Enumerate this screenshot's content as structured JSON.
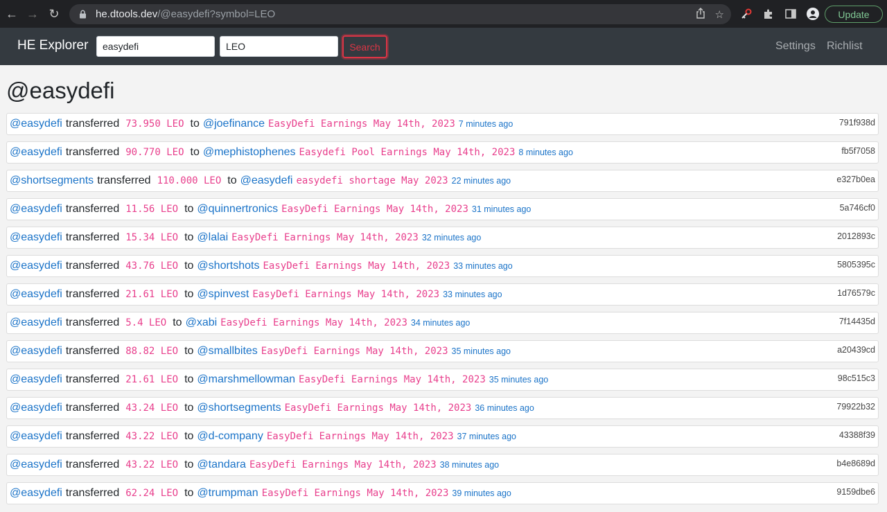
{
  "browser": {
    "url_host": "he.dtools.dev",
    "url_path": "/@easydefi?symbol=LEO",
    "update_label": "Update"
  },
  "navbar": {
    "brand": "HE Explorer",
    "account_value": "easydefi",
    "symbol_value": "LEO",
    "search_label": "Search",
    "settings_label": "Settings",
    "richlist_label": "Richlist"
  },
  "page": {
    "title": "@easydefi"
  },
  "transfers": [
    {
      "from": "@easydefi",
      "verb": "transferred",
      "amount": "73.950 LEO",
      "to_word": "to",
      "to": "@joefinance",
      "memo": "EasyDefi Earnings May 14th, 2023",
      "time": "7 minutes ago",
      "hash": "791f938d"
    },
    {
      "from": "@easydefi",
      "verb": "transferred",
      "amount": "90.770 LEO",
      "to_word": "to",
      "to": "@mephistophenes",
      "memo": "Easydefi Pool Earnings May 14th, 2023",
      "time": "8 minutes ago",
      "hash": "fb5f7058"
    },
    {
      "from": "@shortsegments",
      "verb": "transferred",
      "amount": "110.000 LEO",
      "to_word": "to",
      "to": "@easydefi",
      "memo": "easydefi shortage May 2023",
      "time": "22 minutes ago",
      "hash": "e327b0ea"
    },
    {
      "from": "@easydefi",
      "verb": "transferred",
      "amount": "11.56 LEO",
      "to_word": "to",
      "to": "@quinnertronics",
      "memo": "EasyDefi Earnings May 14th, 2023",
      "time": "31 minutes ago",
      "hash": "5a746cf0"
    },
    {
      "from": "@easydefi",
      "verb": "transferred",
      "amount": "15.34 LEO",
      "to_word": "to",
      "to": "@lalai",
      "memo": "EasyDefi Earnings May 14th, 2023",
      "time": "32 minutes ago",
      "hash": "2012893c"
    },
    {
      "from": "@easydefi",
      "verb": "transferred",
      "amount": "43.76 LEO",
      "to_word": "to",
      "to": "@shortshots",
      "memo": "EasyDefi Earnings May 14th, 2023",
      "time": "33 minutes ago",
      "hash": "5805395c"
    },
    {
      "from": "@easydefi",
      "verb": "transferred",
      "amount": "21.61 LEO",
      "to_word": "to",
      "to": "@spinvest",
      "memo": "EasyDefi Earnings May 14th, 2023",
      "time": "33 minutes ago",
      "hash": "1d76579c"
    },
    {
      "from": "@easydefi",
      "verb": "transferred",
      "amount": "5.4 LEO",
      "to_word": "to",
      "to": "@xabi",
      "memo": "EasyDefi Earnings May 14th, 2023",
      "time": "34 minutes ago",
      "hash": "7f14435d"
    },
    {
      "from": "@easydefi",
      "verb": "transferred",
      "amount": "88.82 LEO",
      "to_word": "to",
      "to": "@smallbites",
      "memo": "EasyDefi Earnings May 14th, 2023",
      "time": "35 minutes ago",
      "hash": "a20439cd"
    },
    {
      "from": "@easydefi",
      "verb": "transferred",
      "amount": "21.61 LEO",
      "to_word": "to",
      "to": "@marshmellowman",
      "memo": "EasyDefi Earnings May 14th, 2023",
      "time": "35 minutes ago",
      "hash": "98c515c3"
    },
    {
      "from": "@easydefi",
      "verb": "transferred",
      "amount": "43.24 LEO",
      "to_word": "to",
      "to": "@shortsegments",
      "memo": "EasyDefi Earnings May 14th, 2023",
      "time": "36 minutes ago",
      "hash": "79922b32"
    },
    {
      "from": "@easydefi",
      "verb": "transferred",
      "amount": "43.22 LEO",
      "to_word": "to",
      "to": "@d-company",
      "memo": "EasyDefi Earnings May 14th, 2023",
      "time": "37 minutes ago",
      "hash": "43388f39"
    },
    {
      "from": "@easydefi",
      "verb": "transferred",
      "amount": "43.22 LEO",
      "to_word": "to",
      "to": "@tandara",
      "memo": "EasyDefi Earnings May 14th, 2023",
      "time": "38 minutes ago",
      "hash": "b4e8689d"
    },
    {
      "from": "@easydefi",
      "verb": "transferred",
      "amount": "62.24 LEO",
      "to_word": "to",
      "to": "@trumpman",
      "memo": "EasyDefi Earnings May 14th, 2023",
      "time": "39 minutes ago",
      "hash": "9159dbe6"
    }
  ]
}
